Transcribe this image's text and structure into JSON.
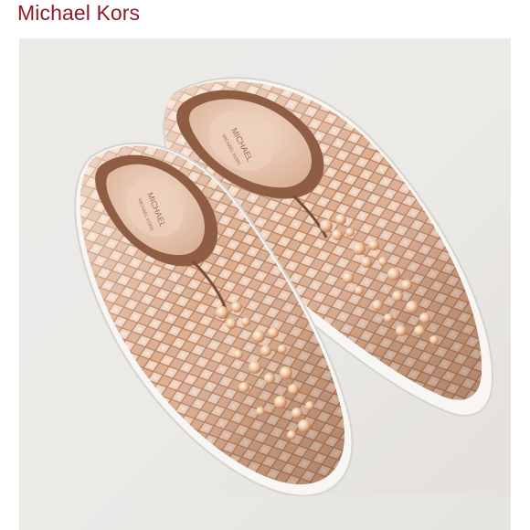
{
  "header": {
    "brand_name": "Michael Kors"
  },
  "product_image": {
    "insole_logo_line1": "MICHAEL",
    "insole_logo_line2": "MICHAEL KORS",
    "colors": {
      "brand_text": "#8a1c2b",
      "background": "#ebeae7",
      "metallic_base": "#d9a686",
      "metallic_highlight": "#f4dccb",
      "metallic_shadow": "#9c6a4e",
      "insole": "#e9c9b1",
      "sole": "#f7f6f3"
    }
  }
}
